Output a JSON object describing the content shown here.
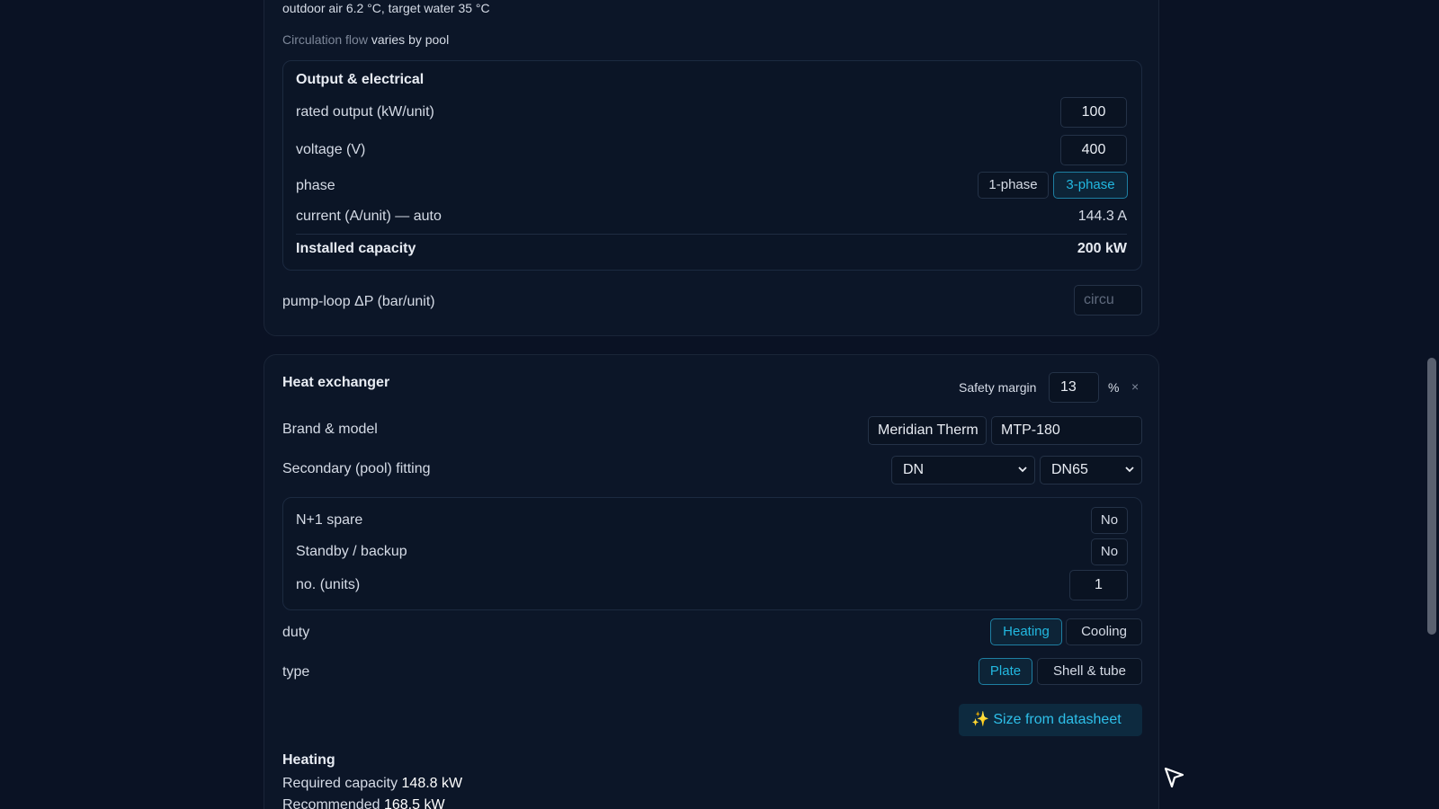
{
  "top_section": {
    "conditions_text": "outdoor air 6.2 °C, target water 35 °C",
    "circulation_label": "Circulation flow",
    "circulation_value": "varies by pool",
    "output_panel": {
      "title": "Output & electrical",
      "rated_output_label": "rated output (kW/unit)",
      "rated_output_value": "100",
      "voltage_label": "voltage (V)",
      "voltage_value": "400",
      "phase_label": "phase",
      "phase_options": [
        "1-phase",
        "3-phase"
      ],
      "phase_selected": "3-phase",
      "current_label": "current (A/unit) — auto",
      "current_value": "144.3 A",
      "installed_label": "Installed capacity",
      "installed_value": "200 kW"
    },
    "pump_label": "pump-loop ΔP (bar/unit)",
    "pump_placeholder": "circu"
  },
  "heat_exchanger": {
    "title": "Heat exchanger",
    "safety_margin_label": "Safety margin",
    "safety_margin_value": "13",
    "safety_margin_unit": "%",
    "close_symbol": "×",
    "brand_label": "Brand & model",
    "brand_value": "Meridian Therm",
    "model_value": "MTP-180",
    "fitting_label": "Secondary (pool) fitting",
    "fitting_standard": "DN",
    "fitting_size": "DN65",
    "redundancy": {
      "n1_label": "N+1 spare",
      "n1_value": "No",
      "standby_label": "Standby / backup",
      "standby_value": "No",
      "units_label": "no. (units)",
      "units_value": "1"
    },
    "duty_label": "duty",
    "duty_options": [
      "Heating",
      "Cooling"
    ],
    "duty_selected": "Heating",
    "type_label": "type",
    "type_options": [
      "Plate",
      "Shell & tube"
    ],
    "type_selected": "Plate",
    "size_button_label": "✨ Size from datasheet",
    "results": {
      "heading": "Heating",
      "required_label": "Required capacity",
      "required_value": "148.8 kW",
      "recommended_label": "Recommended",
      "recommended_value": "168.5 kW"
    }
  },
  "colors": {
    "background": "#0a1224",
    "accent": "#22b8e0"
  }
}
